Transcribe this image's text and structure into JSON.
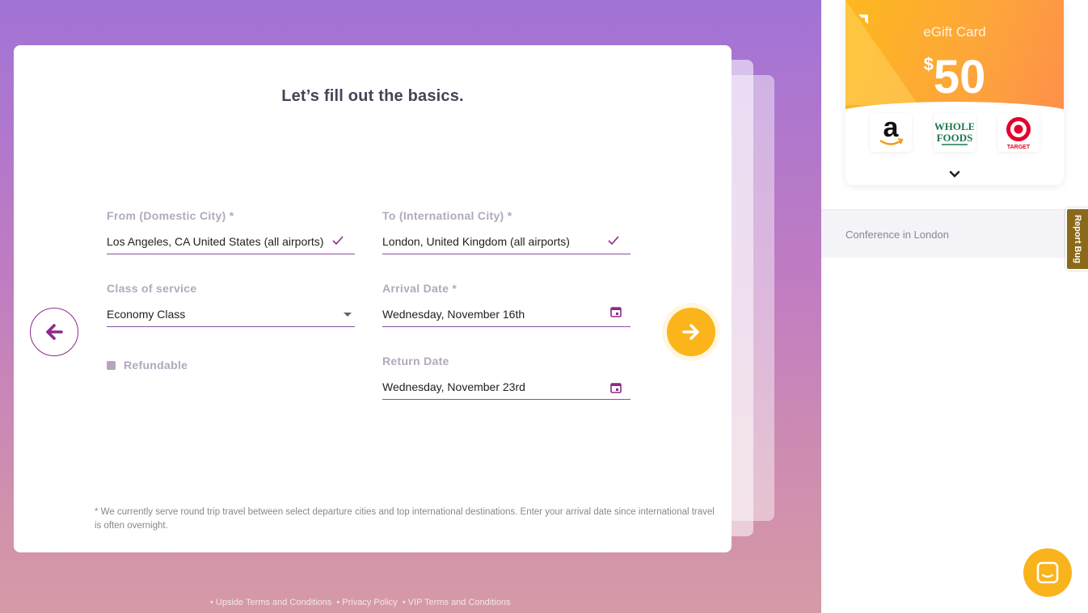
{
  "page": {
    "title": "Let’s fill out the basics."
  },
  "form": {
    "from": {
      "label": "From (Domestic City) *",
      "value": "Los Angeles, CA United States (all airports)"
    },
    "to": {
      "label": "To (International City) *",
      "value": "London, United Kingdom (all airports)"
    },
    "class_of_service": {
      "label": "Class of service",
      "value": "Economy Class"
    },
    "arrival_date": {
      "label": "Arrival Date *",
      "value": "Wednesday, November 16th"
    },
    "return_date": {
      "label": "Return Date",
      "value": "Wednesday, November 23rd"
    },
    "refundable": {
      "label": "Refundable",
      "checked": false
    }
  },
  "footnote": "* We currently serve round trip travel between select departure cities and top international destinations. Enter your arrival date since international travel is often overnight.",
  "footer_links": [
    "• Upside Terms and Conditions",
    "• Privacy Policy",
    "• VIP Terms and Conditions"
  ],
  "gift_card": {
    "title": "eGift Card",
    "currency": "$",
    "amount": "50",
    "brands": [
      "amazon",
      "whole-foods",
      "target"
    ],
    "brand_labels": {
      "wf_line1": "WHOLE",
      "wf_line2": "FOODS",
      "target": "TARGET"
    }
  },
  "sidebar": {
    "trip_name": "Conference in London"
  },
  "report_bug": "Report Bug",
  "colors": {
    "accent_purple": "#8d2a8b",
    "accent_orange": "#fbb41a",
    "label_gray": "#b3a8bd"
  }
}
